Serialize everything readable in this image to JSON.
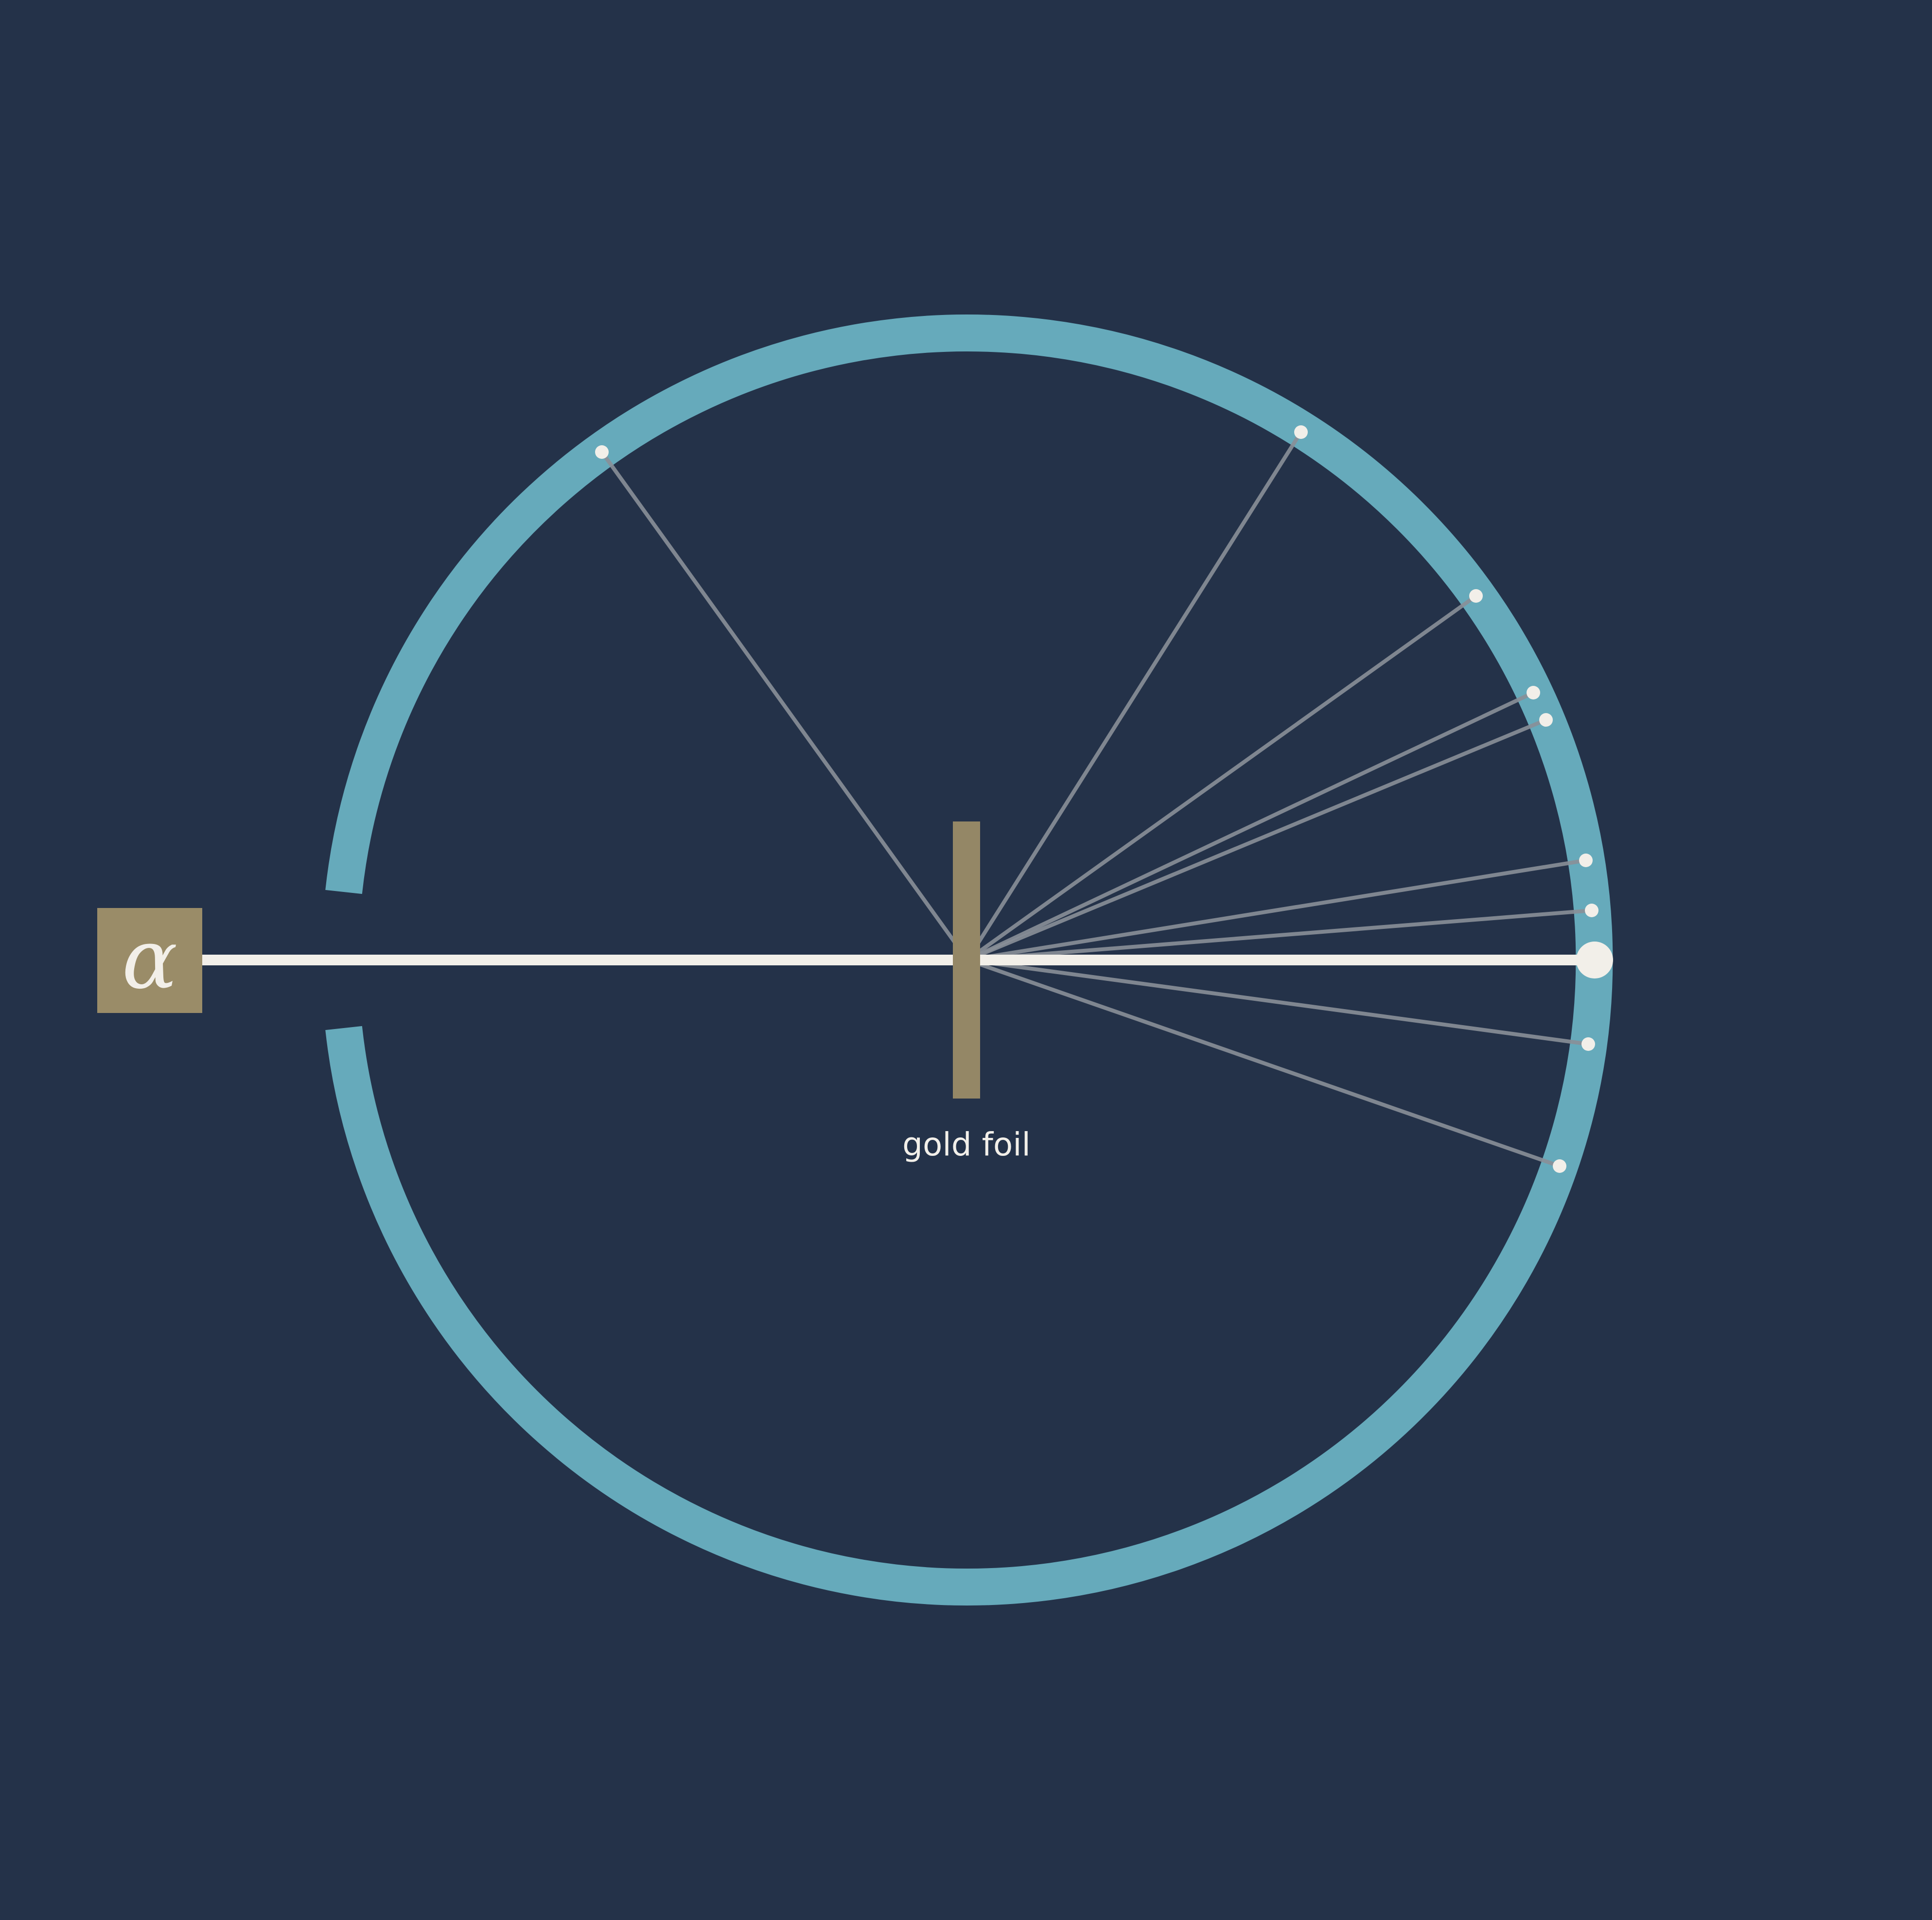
{
  "diagram": {
    "source_symbol": "α",
    "foil_label": "gold foil",
    "colors": {
      "background": "#243249",
      "detector_ring": "#66aabb",
      "source_box": "#9a8c68",
      "foil": "#948766",
      "beam": "#f2efe9",
      "scattered_path": "#8a8f98",
      "hit_dot": "#f2efe9"
    },
    "scattered_hits_count": 10
  }
}
